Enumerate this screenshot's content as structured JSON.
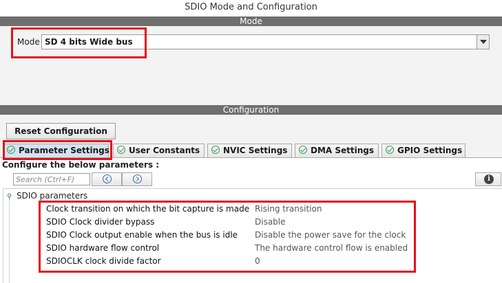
{
  "window": {
    "title": "SDIO Mode and Configuration"
  },
  "mode_section": {
    "header": "Mode",
    "mode_label": "Mode",
    "mode_value": "SD 4 bits Wide bus"
  },
  "config_section": {
    "header": "Configuration",
    "reset_button": "Reset Configuration",
    "tabs": [
      {
        "label": "Parameter Settings",
        "active": true,
        "icon": "check-circle-icon"
      },
      {
        "label": "User Constants",
        "active": false,
        "icon": "check-circle-icon"
      },
      {
        "label": "NVIC Settings",
        "active": false,
        "icon": "check-circle-icon"
      },
      {
        "label": "DMA Settings",
        "active": false,
        "icon": "check-circle-icon"
      },
      {
        "label": "GPIO Settings",
        "active": false,
        "icon": "check-circle-icon"
      }
    ],
    "configure_text": "Configure the below parameters :",
    "search": {
      "placeholder": "Search (Ctrl+F)",
      "value": ""
    },
    "tree": {
      "group_label": "SDIO parameters",
      "params": [
        {
          "name": "Clock transition on which the bit capture is made",
          "value": "Rising transition"
        },
        {
          "name": "SDIO Clock divider bypass",
          "value": "Disable"
        },
        {
          "name": "SDIO Clock output enable when the bus is idle",
          "value": "Disable the power save for the clock"
        },
        {
          "name": "SDIO hardware flow control",
          "value": "The hardware control flow is enabled"
        },
        {
          "name": "SDIOCLK clock divide factor",
          "value": "0"
        }
      ]
    }
  },
  "colors": {
    "section_bar": "#6f6f6f",
    "highlight": "#e3101b",
    "check_icon": "#3a9d5d",
    "nav_icon": "#2f6fad"
  }
}
